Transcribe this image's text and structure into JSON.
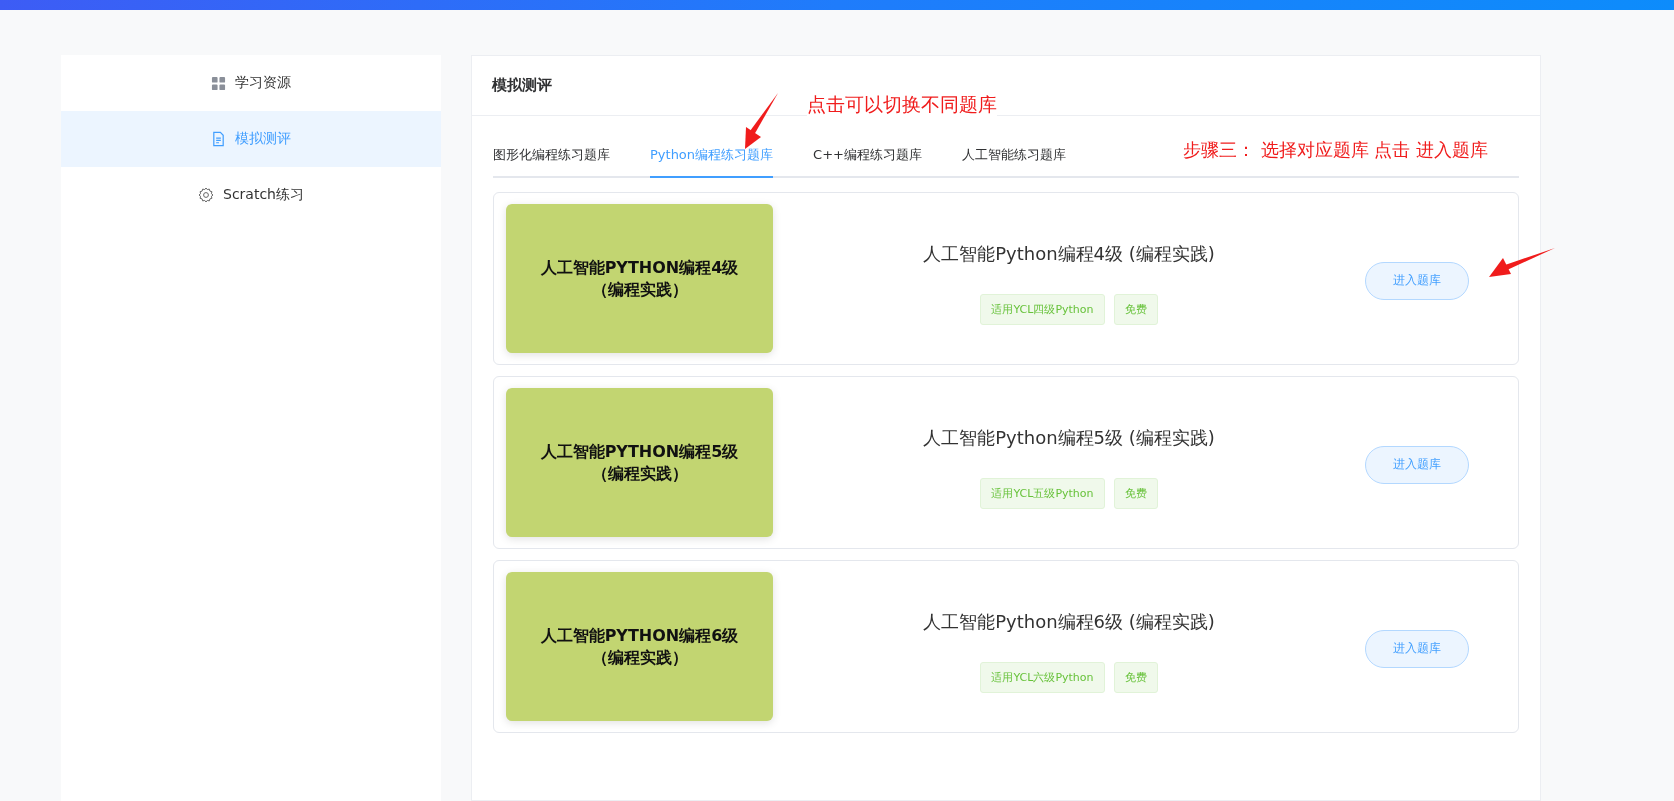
{
  "sidebar": {
    "items": [
      {
        "label": "学习资源",
        "kind": "grid",
        "selected": false
      },
      {
        "label": "模拟测评",
        "kind": "document",
        "selected": true
      },
      {
        "label": "Scratch练习",
        "kind": "gear",
        "selected": false
      }
    ]
  },
  "panel": {
    "title": "模拟测评"
  },
  "tabs": [
    {
      "label": "图形化编程练习题库",
      "selected": false
    },
    {
      "label": "Python编程练习题库",
      "selected": true
    },
    {
      "label": "C++编程练习题库",
      "selected": false
    },
    {
      "label": "人工智能练习题库",
      "selected": false
    }
  ],
  "cards": [
    {
      "cover_lines": [
        "人工智能PYTHON编程4级",
        "（编程实践）"
      ],
      "title": "人工智能Python编程4级 (编程实践)",
      "tags": [
        "适用YCL四级Python",
        "免费"
      ],
      "button": "进入题库"
    },
    {
      "cover_lines": [
        "人工智能PYTHON编程5级",
        "（编程实践）"
      ],
      "title": "人工智能Python编程5级 (编程实践)",
      "tags": [
        "适用YCL五级Python",
        "免费"
      ],
      "button": "进入题库"
    },
    {
      "cover_lines": [
        "人工智能PYTHON编程6级",
        "（编程实践）"
      ],
      "title": "人工智能Python编程6级 (编程实践)",
      "tags": [
        "适用YCL六级Python",
        "免费"
      ],
      "button": "进入题库"
    }
  ],
  "annotations": [
    "点击可以切换不同题库",
    "步骤三： 选择对应题库 点击 进入题库"
  ]
}
